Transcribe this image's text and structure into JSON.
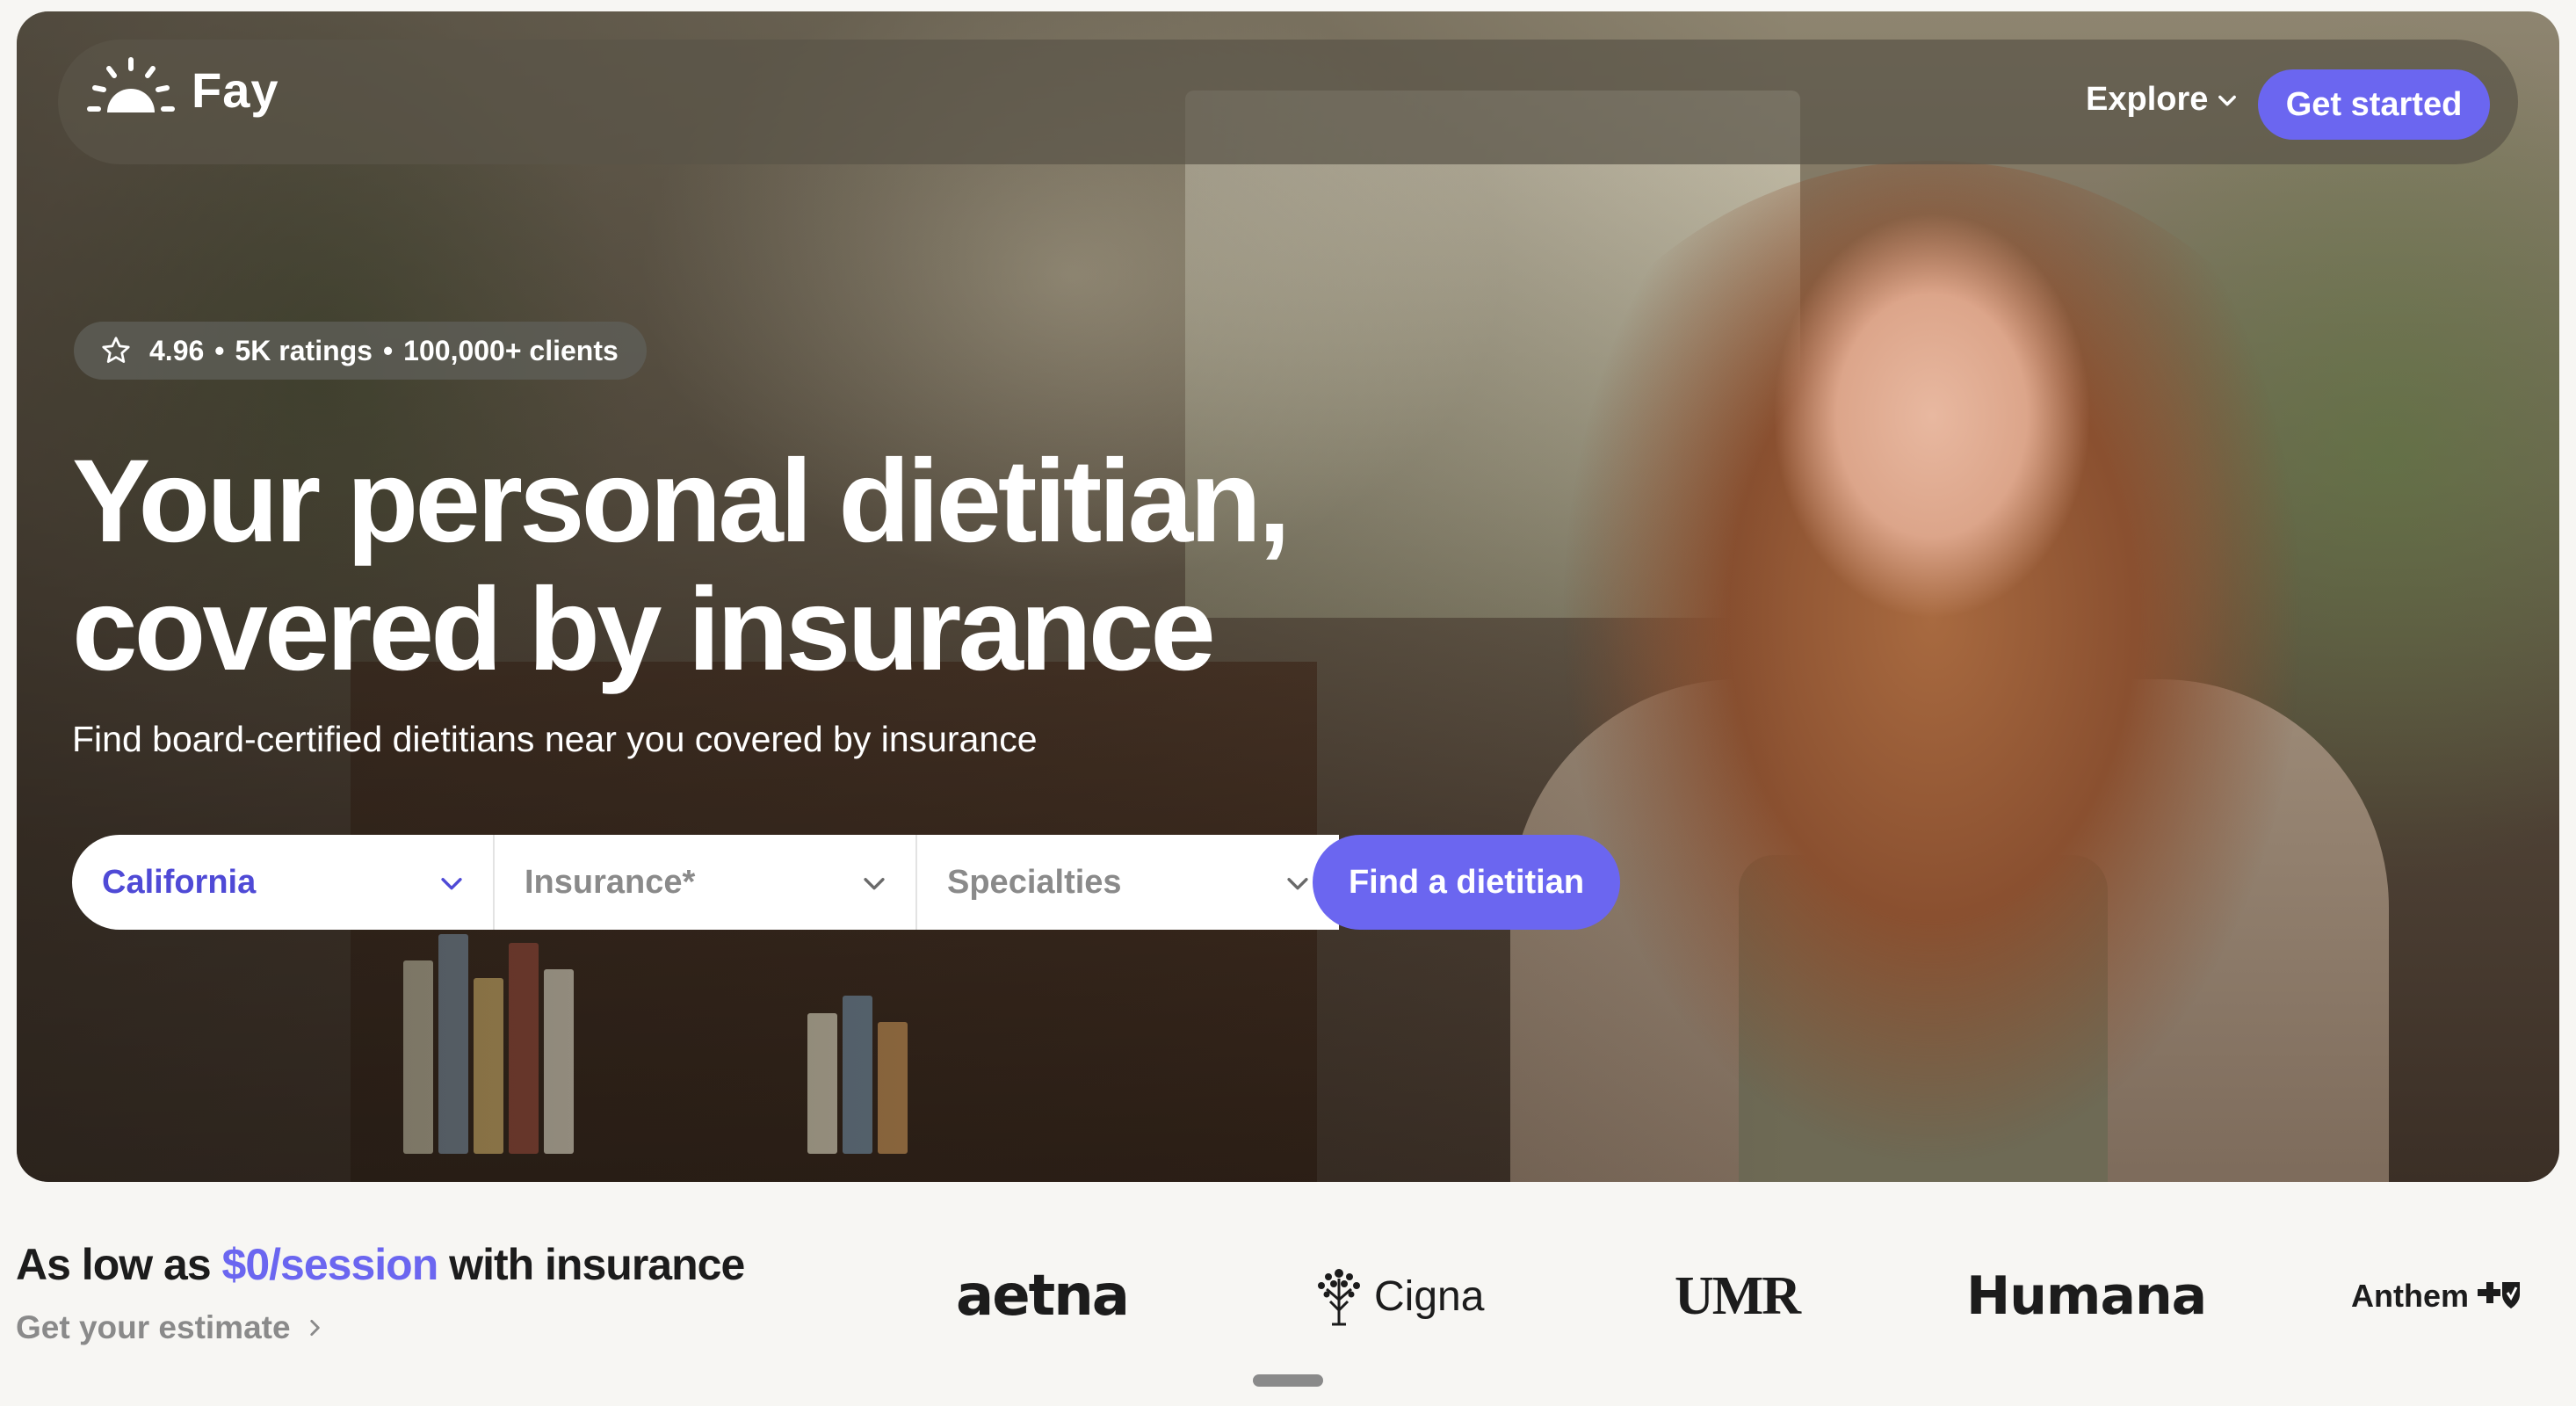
{
  "brand": {
    "name": "Fay",
    "logo_icon": "sun-icon"
  },
  "nav": {
    "explore_label": "Explore",
    "cta_label": "Get started"
  },
  "hero": {
    "rating": "4.96",
    "ratings_count": "5K ratings",
    "clients": "100,000+ clients",
    "headline_line1": "Your personal dietitian,",
    "headline_line2": "covered by insurance",
    "subheadline": "Find board-certified dietitians near you covered by insurance"
  },
  "search": {
    "state_value": "California",
    "insurance_placeholder": "Insurance*",
    "specialties_placeholder": "Specialties",
    "submit_label": "Find a dietitian"
  },
  "pricing": {
    "prefix": "As low as",
    "price": "$0/session",
    "suffix": "with insurance",
    "estimate_link": "Get your estimate"
  },
  "insurers": [
    "aetna",
    "Cigna",
    "UMR",
    "Humana",
    "Anthem"
  ],
  "colors": {
    "accent": "#6b66f0",
    "accent_text": "#4f4ad6",
    "muted": "#8a8a8a",
    "page_bg": "#f7f6f3"
  }
}
